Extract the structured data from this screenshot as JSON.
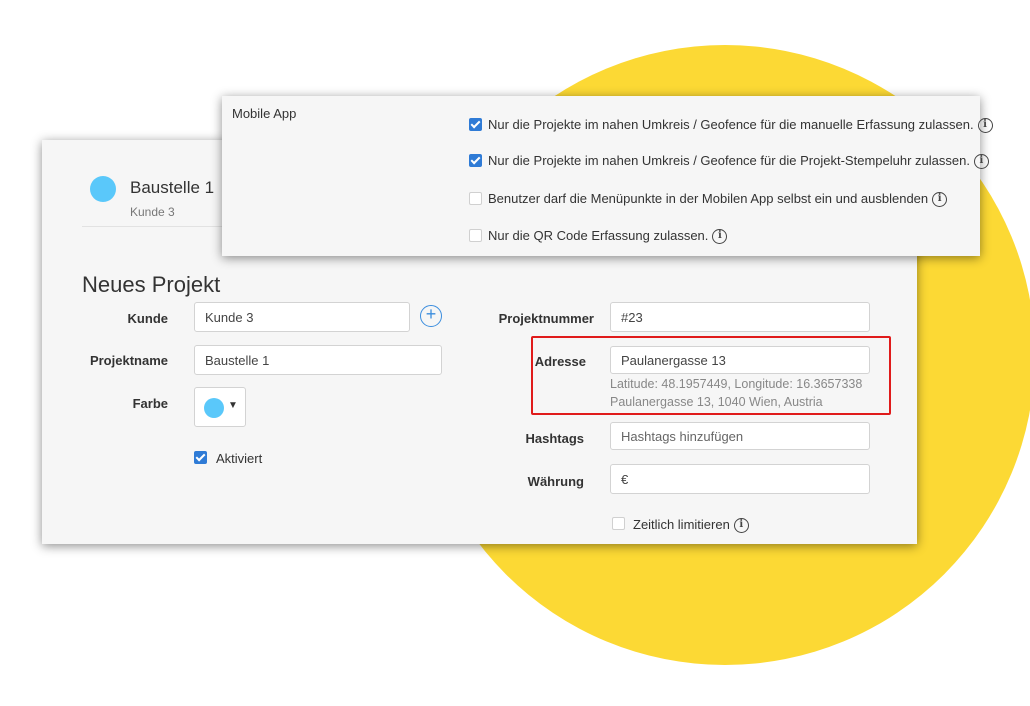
{
  "header": {
    "project_name": "Baustelle 1",
    "client_name": "Kunde 3"
  },
  "form": {
    "title": "Neues Projekt",
    "client": {
      "label": "Kunde",
      "value": "Kunde 3"
    },
    "project_name": {
      "label": "Projektname",
      "value": "Baustelle 1"
    },
    "color": {
      "label": "Farbe",
      "value": "#5ac8fa"
    },
    "active": {
      "label": "Aktiviert",
      "checked": true
    },
    "project_number": {
      "label": "Projektnummer",
      "value": "#23"
    },
    "address": {
      "label": "Adresse",
      "value": "Paulanergasse 13",
      "coordinates": "Latitude: 48.1957449, Longitude: 16.3657338",
      "resolved": "Paulanergasse 13, 1040 Wien, Austria"
    },
    "hashtags": {
      "label": "Hashtags",
      "placeholder": "Hashtags hinzufügen"
    },
    "currency": {
      "label": "Währung",
      "value": "€"
    },
    "time_limit": {
      "label": "Zeitlich limitieren",
      "checked": false
    }
  },
  "mobile_app": {
    "section_label": "Mobile App",
    "options": [
      {
        "label": "Nur die Projekte im nahen Umkreis / Geofence für die manuelle Erfassung zulassen.",
        "checked": true
      },
      {
        "label": "Nur die Projekte im nahen Umkreis / Geofence für die Projekt-Stempeluhr zulassen.",
        "checked": true
      },
      {
        "label": "Benutzer darf die Menüpunkte in der Mobilen App selbst ein und ausblenden",
        "checked": false
      },
      {
        "label": "Nur die QR Code Erfassung zulassen.",
        "checked": false
      }
    ]
  },
  "colors": {
    "accent": "#2f7bd6",
    "highlight": "#e01b1b",
    "background_shape": "#fcd934",
    "project_color": "#5ac8fa"
  },
  "icons": {
    "info": "info-icon",
    "add": "plus-circle-icon",
    "dropdown": "caret-down-icon"
  }
}
